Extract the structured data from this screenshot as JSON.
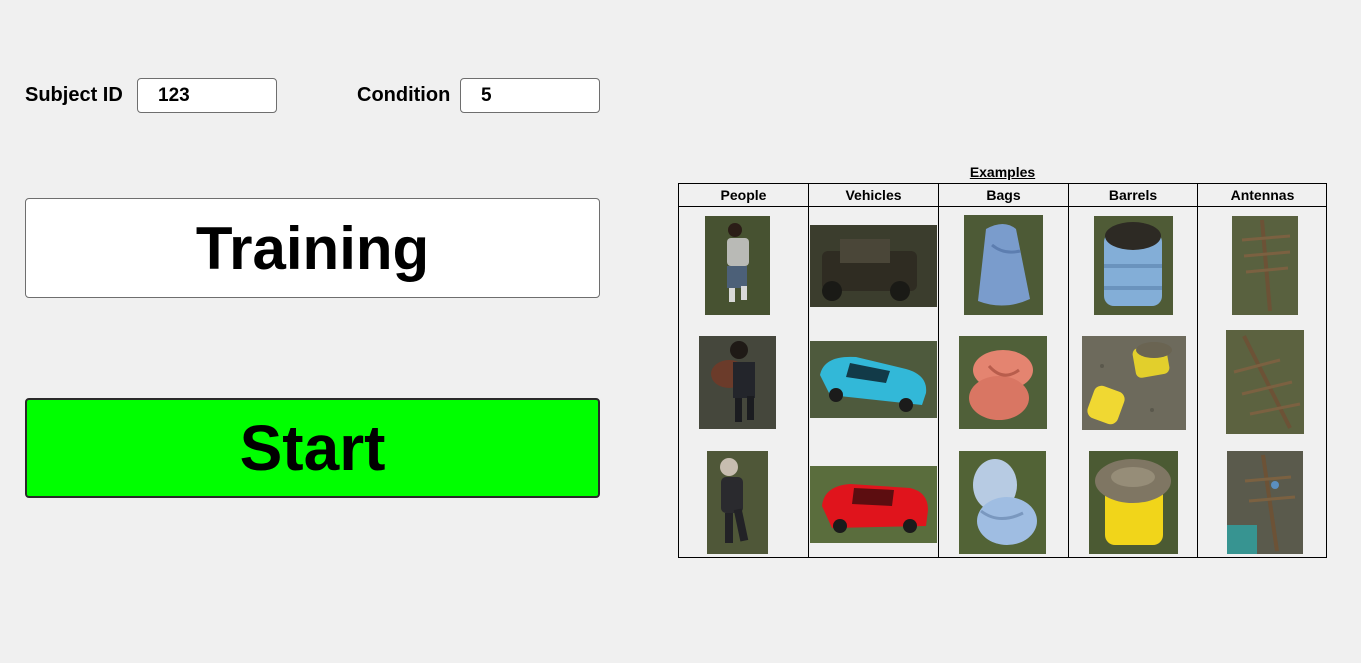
{
  "form": {
    "subject_id_label": "Subject ID",
    "subject_id_value": "123",
    "condition_label": "Condition",
    "condition_value": "5"
  },
  "buttons": {
    "training_label": "Training",
    "start_label": "Start",
    "start_color": "#00ff00"
  },
  "examples": {
    "title": "Examples",
    "categories": [
      "People",
      "Vehicles",
      "Bags",
      "Barrels",
      "Antennas"
    ],
    "thumbnails": [
      [
        "person-grey-shirt",
        "military-vehicle-dark",
        "blue-sack",
        "blue-barrel",
        "wooden-antenna-pole"
      ],
      [
        "person-carrying-load",
        "blue-car",
        "orange-sacks",
        "yellow-barrels-tipped",
        "fallen-antenna-pole"
      ],
      [
        "person-dark-suit",
        "red-sports-car",
        "white-blue-sacks",
        "yellow-barrel-lid",
        "antenna-pole-water"
      ]
    ]
  }
}
